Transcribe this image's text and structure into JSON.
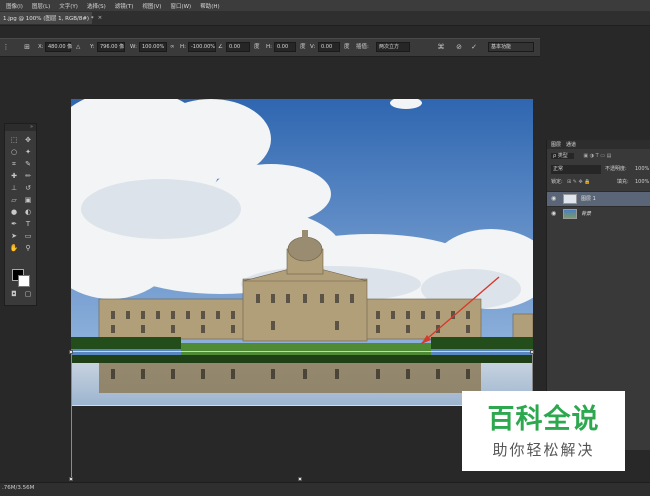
{
  "menu": [
    "图像(I)",
    "图层(L)",
    "文字(Y)",
    "选择(S)",
    "滤镜(T)",
    "视图(V)",
    "窗口(W)",
    "帮助(H)"
  ],
  "document_tab": {
    "title": "1.jpg @ 100% (图层 1, RGB/8#) *",
    "close": "×"
  },
  "options": {
    "x_label": "X:",
    "x_value": "480.00 像",
    "y_label": "Y:",
    "y_value": "796.00 像",
    "w_label": "W:",
    "w_value": "100.00%",
    "h_label": "H:",
    "h_value": "-100.00%",
    "angle_value": "0.00",
    "angle_unit": "度",
    "hskew_label": "H:",
    "hskew_value": "0.00",
    "hskew_unit": "度",
    "vskew_label": "V:",
    "vskew_value": "0.00",
    "vskew_unit": "度",
    "interp_label": "插值:",
    "interp_value": "两次立方",
    "workspace": "基本功能"
  },
  "layers_panel": {
    "tabs": [
      "图层",
      "通道"
    ],
    "kind": "ρ 类型",
    "blend_mode": "正常",
    "opacity_label": "不透明度:",
    "opacity_value": "100%",
    "lock_label": "锁定:",
    "fill_label": "填充:",
    "fill_value": "100%",
    "layers": [
      {
        "name": "图层 1"
      },
      {
        "name": "背景"
      }
    ]
  },
  "status": {
    "doc_size": ".76M/3.56M"
  },
  "watermark": {
    "title": "百科全说",
    "subtitle": "助你轻松解决"
  },
  "colors": {
    "accent_green": "#2da84e",
    "sky": "#3f74b8",
    "grass": "#3f7a2c",
    "arrow": "#d63a2b"
  },
  "icons": [
    "move-icon",
    "marquee-icon",
    "lasso-icon",
    "magic-wand-icon",
    "crop-icon",
    "eyedropper-icon",
    "healing-icon",
    "brush-icon",
    "stamp-icon",
    "history-brush-icon",
    "eraser-icon",
    "gradient-icon",
    "blur-icon",
    "dodge-icon",
    "pen-icon",
    "type-icon",
    "path-select-icon",
    "shape-icon",
    "hand-icon",
    "zoom-icon"
  ]
}
